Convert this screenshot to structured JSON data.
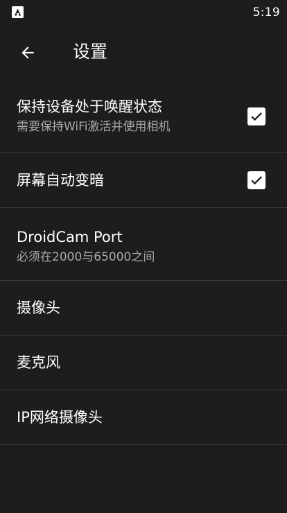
{
  "status_bar": {
    "time": "5:19",
    "app_icon": "app-notification-icon"
  },
  "app_bar": {
    "back_icon": "arrow-left-icon",
    "title": "设置"
  },
  "settings": [
    {
      "title": "保持设备处于唤醒状态",
      "summary": "需要保持WiFi激活并使用相机",
      "checked": true
    },
    {
      "title": "屏幕自动变暗",
      "checked": true
    },
    {
      "title": "DroidCam Port",
      "summary": "必须在2000与65000之间"
    },
    {
      "title": "摄像头"
    },
    {
      "title": "麦克风"
    },
    {
      "title": "IP网络摄像头"
    }
  ],
  "colors": {
    "background": "#1d1d1d",
    "divider": "#3a3a3a",
    "summary_text": "#a9a9a9",
    "checkbox_fill": "#ffffff",
    "checkmark": "#1d1d1d"
  }
}
